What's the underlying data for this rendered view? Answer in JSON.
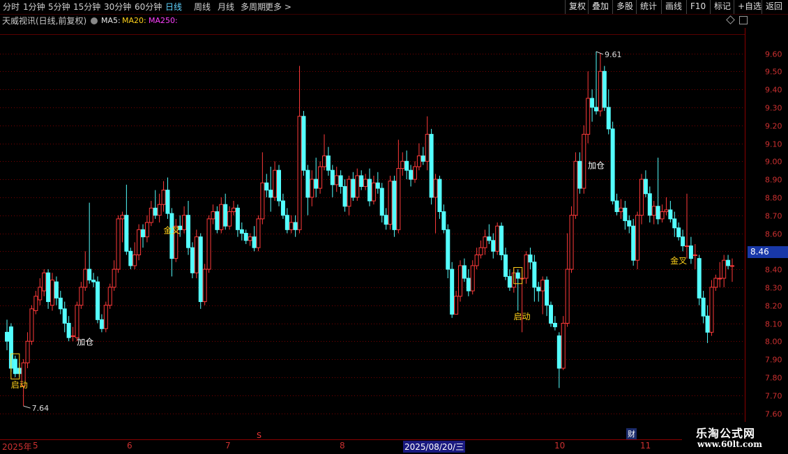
{
  "toolbar": {
    "periods": [
      "分时",
      "1分钟",
      "5分钟",
      "15分钟",
      "30分钟",
      "60分钟",
      "日线",
      "周线",
      "月线",
      "多周期",
      "更多 >"
    ],
    "active_period": "日线",
    "right_buttons": [
      "复权",
      "叠加",
      "多股",
      "统计",
      "画线",
      "F10",
      "标记",
      "+自选",
      "返回"
    ]
  },
  "info": {
    "title": "天威视讯(日线,前复权)",
    "ma5": "MA5:",
    "ma20": "MA20:",
    "ma250": "MA250:"
  },
  "current_price": "8.46",
  "x_axis": {
    "year_label": "2025年",
    "month_labels": [
      "5",
      "6",
      "7",
      "8",
      "10",
      "11"
    ],
    "selected_date": "2025/08/20/三",
    "marker_s": "S",
    "marker_cai": "财"
  },
  "watermark": {
    "line1": "乐淘公式网",
    "line2": "www.60lt.com"
  },
  "colors": {
    "up": "#ff3a3a",
    "down": "#54ffff",
    "grid": "#7a0000",
    "yellow": "#ffd21a",
    "orange": "#ff9a28",
    "white": "#ffffff"
  },
  "chart_data": {
    "type": "candlestick",
    "y_tick_labels": [
      "9.60",
      "9.50",
      "9.40",
      "9.30",
      "9.20",
      "9.10",
      "9.00",
      "8.90",
      "8.80",
      "8.70",
      "8.60",
      "8.50",
      "8.40",
      "8.30",
      "8.20",
      "8.10",
      "8.00",
      "7.90",
      "7.80",
      "7.70",
      "7.60"
    ],
    "ylim": [
      7.6,
      9.65
    ],
    "high_label": "9.61",
    "low_label": "7.64",
    "annotations": [
      {
        "text": "启动",
        "index": 3,
        "price": 7.76,
        "color": "yellow"
      },
      {
        "text": "加仓",
        "index": 19,
        "price": 8.0,
        "color": "white"
      },
      {
        "text": "金叉",
        "index": 40,
        "price": 8.62,
        "color": "yellow"
      },
      {
        "text": "启动",
        "index": 125,
        "price": 8.14,
        "color": "yellow"
      },
      {
        "text": "加仓",
        "index": 143,
        "price": 8.98,
        "color": "white"
      },
      {
        "text": "金叉",
        "index": 163,
        "price": 8.45,
        "color": "yellow"
      }
    ],
    "start_signal_boxes": [
      2,
      124
    ],
    "candles": [
      [
        8.05,
        8.0,
        8.12,
        7.95
      ],
      [
        8.08,
        7.85,
        8.1,
        7.83
      ],
      [
        7.9,
        7.82,
        7.92,
        7.8
      ],
      [
        7.85,
        7.82,
        7.88,
        7.8
      ],
      [
        7.75,
        7.88,
        7.9,
        7.64
      ],
      [
        7.88,
        8.0,
        8.05,
        7.85
      ],
      [
        8.0,
        8.18,
        8.2,
        7.98
      ],
      [
        8.17,
        8.25,
        8.28,
        8.15
      ],
      [
        8.23,
        8.3,
        8.35,
        8.2
      ],
      [
        8.28,
        8.38,
        8.4,
        8.25
      ],
      [
        8.38,
        8.22,
        8.4,
        8.18
      ],
      [
        8.2,
        8.34,
        8.38,
        8.17
      ],
      [
        8.33,
        8.24,
        8.36,
        8.2
      ],
      [
        8.24,
        8.18,
        8.28,
        8.15
      ],
      [
        8.18,
        8.1,
        8.22,
        8.05
      ],
      [
        8.1,
        8.02,
        8.14,
        8.0
      ],
      [
        8.03,
        8.03,
        8.08,
        8.0
      ],
      [
        8.02,
        8.2,
        8.22,
        8.0
      ],
      [
        8.2,
        8.3,
        8.33,
        8.18
      ],
      [
        8.3,
        8.4,
        8.5,
        8.28
      ],
      [
        8.4,
        8.34,
        8.77,
        8.32
      ],
      [
        8.34,
        8.33,
        8.38,
        8.3
      ],
      [
        8.33,
        8.12,
        8.36,
        8.1
      ],
      [
        8.12,
        8.07,
        8.15,
        8.05
      ],
      [
        8.07,
        8.2,
        8.22,
        8.05
      ],
      [
        8.2,
        8.3,
        8.32,
        8.18
      ],
      [
        8.3,
        8.4,
        8.45,
        8.28
      ],
      [
        8.4,
        8.68,
        8.7,
        8.38
      ],
      [
        8.68,
        8.7,
        8.72,
        8.55
      ],
      [
        8.7,
        8.5,
        8.87,
        8.48
      ],
      [
        8.5,
        8.42,
        8.52,
        8.4
      ],
      [
        8.42,
        8.48,
        8.55,
        8.4
      ],
      [
        8.48,
        8.62,
        8.65,
        8.45
      ],
      [
        8.62,
        8.58,
        8.65,
        8.52
      ],
      [
        8.58,
        8.66,
        8.7,
        8.55
      ],
      [
        8.66,
        8.74,
        8.78,
        8.64
      ],
      [
        8.74,
        8.7,
        8.84,
        8.68
      ],
      [
        8.7,
        8.76,
        8.82,
        8.66
      ],
      [
        8.76,
        8.84,
        8.89,
        8.72
      ],
      [
        8.84,
        8.71,
        8.91,
        8.68
      ],
      [
        8.71,
        8.46,
        8.74,
        8.36
      ],
      [
        8.46,
        8.64,
        8.68,
        8.44
      ],
      [
        8.64,
        8.62,
        8.7,
        8.58
      ],
      [
        8.62,
        8.7,
        8.75,
        8.6
      ],
      [
        8.7,
        8.52,
        8.78,
        8.48
      ],
      [
        8.52,
        8.38,
        8.55,
        8.35
      ],
      [
        8.38,
        8.58,
        8.62,
        8.35
      ],
      [
        8.58,
        8.22,
        8.6,
        8.18
      ],
      [
        8.22,
        8.4,
        8.43,
        8.2
      ],
      [
        8.4,
        8.68,
        8.7,
        8.38
      ],
      [
        8.68,
        8.72,
        8.76,
        8.65
      ],
      [
        8.72,
        8.62,
        8.75,
        8.6
      ],
      [
        8.62,
        8.76,
        8.8,
        8.6
      ],
      [
        8.76,
        8.64,
        8.82,
        8.62
      ],
      [
        8.64,
        8.72,
        8.75,
        8.62
      ],
      [
        8.72,
        8.74,
        8.78,
        8.7
      ],
      [
        8.74,
        8.62,
        8.76,
        8.58
      ],
      [
        8.62,
        8.6,
        8.66,
        8.56
      ],
      [
        8.6,
        8.56,
        8.62,
        8.54
      ],
      [
        8.56,
        8.58,
        8.6,
        8.53
      ],
      [
        8.58,
        8.52,
        8.64,
        8.5
      ],
      [
        8.52,
        8.68,
        8.7,
        8.5
      ],
      [
        8.68,
        8.88,
        9.05,
        8.65
      ],
      [
        8.88,
        8.84,
        8.93,
        8.8
      ],
      [
        8.84,
        8.8,
        8.97,
        8.72
      ],
      [
        8.8,
        8.95,
        9.0,
        8.78
      ],
      [
        8.95,
        8.78,
        8.98,
        8.75
      ],
      [
        8.78,
        8.7,
        8.82,
        8.68
      ],
      [
        8.7,
        8.62,
        8.74,
        8.6
      ],
      [
        8.62,
        8.66,
        8.7,
        8.6
      ],
      [
        8.66,
        8.62,
        8.7,
        8.58
      ],
      [
        8.62,
        9.25,
        9.53,
        8.6
      ],
      [
        9.25,
        8.95,
        9.28,
        8.92
      ],
      [
        8.95,
        8.8,
        8.98,
        8.7
      ],
      [
        8.8,
        8.9,
        8.95,
        8.75
      ],
      [
        8.9,
        8.85,
        9.02,
        8.8
      ],
      [
        8.85,
        8.97,
        9.0,
        8.82
      ],
      [
        8.97,
        9.03,
        9.15,
        8.95
      ],
      [
        9.03,
        8.95,
        9.08,
        8.92
      ],
      [
        8.95,
        8.87,
        8.98,
        8.8
      ],
      [
        8.87,
        8.92,
        8.97,
        8.83
      ],
      [
        8.92,
        8.86,
        8.95,
        8.82
      ],
      [
        8.86,
        8.75,
        8.9,
        8.72
      ],
      [
        8.75,
        8.9,
        8.92,
        8.7
      ],
      [
        8.9,
        8.8,
        8.94,
        8.78
      ],
      [
        8.8,
        8.92,
        8.96,
        8.78
      ],
      [
        8.92,
        8.86,
        8.95,
        8.84
      ],
      [
        8.86,
        8.9,
        8.93,
        8.84
      ],
      [
        8.9,
        8.78,
        8.96,
        8.75
      ],
      [
        8.78,
        8.88,
        8.92,
        8.76
      ],
      [
        8.88,
        8.85,
        8.94,
        8.82
      ],
      [
        8.85,
        8.7,
        8.88,
        8.66
      ],
      [
        8.7,
        8.65,
        8.74,
        8.62
      ],
      [
        8.65,
        8.89,
        8.92,
        8.62
      ],
      [
        8.89,
        8.62,
        8.92,
        8.58
      ],
      [
        8.62,
        8.96,
        9.12,
        8.6
      ],
      [
        8.96,
        9.0,
        9.05,
        8.92
      ],
      [
        9.0,
        8.95,
        9.06,
        8.9
      ],
      [
        8.95,
        8.9,
        8.98,
        8.86
      ],
      [
        8.9,
        8.97,
        9.0,
        8.88
      ],
      [
        8.97,
        9.03,
        9.1,
        8.95
      ],
      [
        9.03,
        9.0,
        9.08,
        8.98
      ],
      [
        9.0,
        9.15,
        9.25,
        8.95
      ],
      [
        9.15,
        8.8,
        9.18,
        8.76
      ],
      [
        8.8,
        8.9,
        8.93,
        8.6
      ],
      [
        8.9,
        8.72,
        8.92,
        8.68
      ],
      [
        8.72,
        8.62,
        8.76,
        8.6
      ],
      [
        8.62,
        8.4,
        8.65,
        8.35
      ],
      [
        8.4,
        8.15,
        8.44,
        8.13
      ],
      [
        8.15,
        8.25,
        8.28,
        8.15
      ],
      [
        8.25,
        8.42,
        8.45,
        8.22
      ],
      [
        8.42,
        8.35,
        8.46,
        8.33
      ],
      [
        8.35,
        8.28,
        8.4,
        8.25
      ],
      [
        8.28,
        8.42,
        8.45,
        8.26
      ],
      [
        8.42,
        8.48,
        8.52,
        8.4
      ],
      [
        8.48,
        8.52,
        8.56,
        8.46
      ],
      [
        8.52,
        8.58,
        8.62,
        8.48
      ],
      [
        8.58,
        8.56,
        8.65,
        8.54
      ],
      [
        8.56,
        8.5,
        8.6,
        8.46
      ],
      [
        8.5,
        8.64,
        8.66,
        8.48
      ],
      [
        8.64,
        8.48,
        8.66,
        8.45
      ],
      [
        8.48,
        8.36,
        8.52,
        8.34
      ],
      [
        8.36,
        8.3,
        8.4,
        8.28
      ],
      [
        8.3,
        8.38,
        8.41,
        8.27
      ],
      [
        8.38,
        8.35,
        8.4,
        8.17
      ],
      [
        8.35,
        8.35,
        8.4,
        8.05
      ],
      [
        8.35,
        8.48,
        8.5,
        8.32
      ],
      [
        8.48,
        8.44,
        8.52,
        8.4
      ],
      [
        8.44,
        8.3,
        8.48,
        8.22
      ],
      [
        8.3,
        8.28,
        8.33,
        8.22
      ],
      [
        8.28,
        8.34,
        8.36,
        8.15
      ],
      [
        8.34,
        8.2,
        8.36,
        8.14
      ],
      [
        8.2,
        8.1,
        8.22,
        8.08
      ],
      [
        8.1,
        8.08,
        8.14,
        8.06
      ],
      [
        8.03,
        7.85,
        8.05,
        7.74
      ],
      [
        7.85,
        8.1,
        8.14,
        7.84
      ],
      [
        8.1,
        8.4,
        8.6,
        8.08
      ],
      [
        8.4,
        8.7,
        8.75,
        8.38
      ],
      [
        8.7,
        9.0,
        9.05,
        8.68
      ],
      [
        9.0,
        8.85,
        9.05,
        8.82
      ],
      [
        8.85,
        9.15,
        9.2,
        8.82
      ],
      [
        9.15,
        9.35,
        9.5,
        9.1
      ],
      [
        9.35,
        9.3,
        9.4,
        9.22
      ],
      [
        9.3,
        9.28,
        9.61,
        9.26
      ],
      [
        9.28,
        9.5,
        9.6,
        9.25
      ],
      [
        9.5,
        9.3,
        9.53,
        9.28
      ],
      [
        9.3,
        9.18,
        9.4,
        9.15
      ],
      [
        9.18,
        8.78,
        9.22,
        8.76
      ],
      [
        8.78,
        8.72,
        8.82,
        8.7
      ],
      [
        8.72,
        8.74,
        8.79,
        8.68
      ],
      [
        8.74,
        8.67,
        8.78,
        8.62
      ],
      [
        8.67,
        8.64,
        8.7,
        8.6
      ],
      [
        8.64,
        8.45,
        8.68,
        8.42
      ],
      [
        8.45,
        8.7,
        8.72,
        8.4
      ],
      [
        8.7,
        8.9,
        8.93,
        8.65
      ],
      [
        8.9,
        8.82,
        8.95,
        8.8
      ],
      [
        8.82,
        8.7,
        8.86,
        8.66
      ],
      [
        8.7,
        8.75,
        8.78,
        8.65
      ],
      [
        8.75,
        8.68,
        9.02,
        8.65
      ],
      [
        8.68,
        8.72,
        8.76,
        8.66
      ],
      [
        8.72,
        8.73,
        8.8,
        8.7
      ],
      [
        8.73,
        8.68,
        8.78,
        8.66
      ],
      [
        8.68,
        8.63,
        8.72,
        8.58
      ],
      [
        8.63,
        8.58,
        8.66,
        8.56
      ],
      [
        8.58,
        8.53,
        8.62,
        8.5
      ],
      [
        8.53,
        8.53,
        8.82,
        8.46
      ],
      [
        8.53,
        8.46,
        8.58,
        8.43
      ],
      [
        8.48,
        8.48,
        8.54,
        8.4
      ],
      [
        8.46,
        8.24,
        8.48,
        8.2
      ],
      [
        8.24,
        8.14,
        8.28,
        8.1
      ],
      [
        8.14,
        8.05,
        8.2,
        7.99
      ],
      [
        8.05,
        8.3,
        8.34,
        8.03
      ],
      [
        8.3,
        8.35,
        8.37,
        8.28
      ],
      [
        8.35,
        8.35,
        8.44,
        8.3
      ],
      [
        8.35,
        8.45,
        8.48,
        8.3
      ],
      [
        8.45,
        8.42,
        8.48,
        8.4
      ],
      [
        8.42,
        8.42,
        8.46,
        8.33
      ]
    ]
  }
}
